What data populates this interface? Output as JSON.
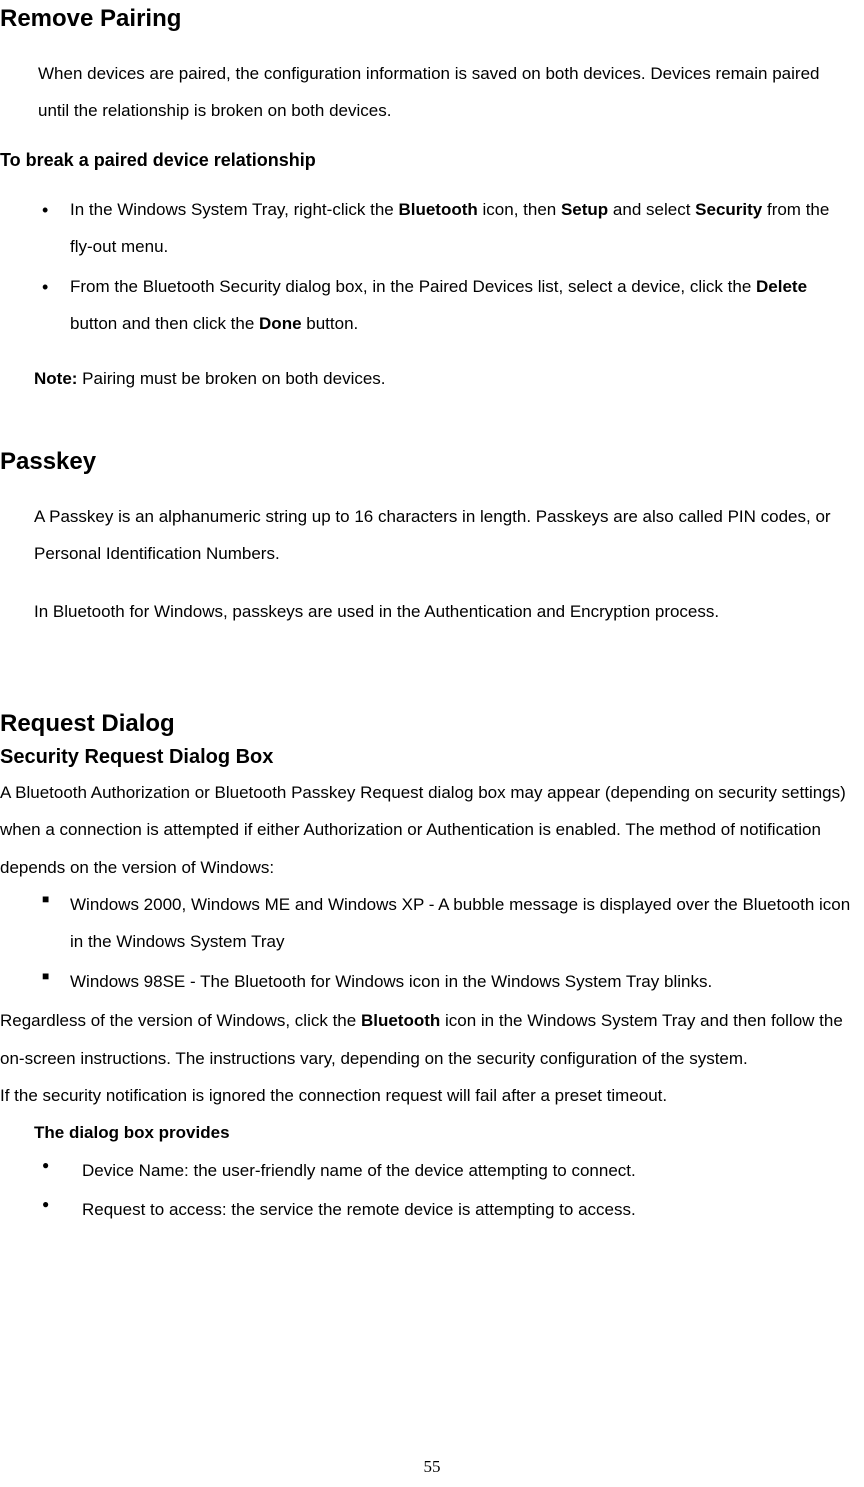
{
  "section1": {
    "heading": "Remove Pairing",
    "intro": "When devices are paired, the configuration information is saved on both devices. Devices remain paired until the relationship is broken on both devices.",
    "subheading": "To break a paired device relationship",
    "bullets": [
      {
        "pre": "In the Windows System Tray, right-click the ",
        "b1": "Bluetooth",
        "mid1": " icon, then ",
        "b2": "Setup",
        "mid2": " and select ",
        "b3": "Security",
        "post": " from the fly-out menu."
      },
      {
        "pre": "From the Bluetooth Security dialog box, in the Paired Devices list, select a device, click the ",
        "b1": "Delete",
        "mid1": " button and then click the ",
        "b2": "Done",
        "post": " button."
      }
    ],
    "note_label": "Note:",
    "note_text": " Pairing must be broken on both devices."
  },
  "section2": {
    "heading": "Passkey",
    "para1": "A Passkey is an alphanumeric string up to 16 characters in length. Passkeys are also called PIN codes, or Personal Identification Numbers.",
    "para2": "In Bluetooth for Windows, passkeys are used in the Authentication and Encryption process."
  },
  "section3": {
    "heading": "Request Dialog",
    "subheading": "Security Request Dialog Box",
    "intro": "A Bluetooth Authorization or Bluetooth Passkey Request dialog box may appear (depending on security settings) when a connection is attempted if either Authorization or Authentication is enabled. The method of notification depends on the version of Windows:",
    "bullets1": [
      "Windows 2000, Windows ME and Windows XP - A bubble message is displayed over the Bluetooth icon in the Windows System Tray",
      "Windows 98SE - The Bluetooth for Windows icon in the Windows System Tray blinks."
    ],
    "para_regardless_pre": "Regardless of the version of Windows, click the ",
    "para_regardless_bold": "Bluetooth",
    "para_regardless_post": " icon in the Windows System Tray and then follow the on-screen instructions. The instructions vary, depending on the security configuration of the system.",
    "para_ignored": "If the security notification is ignored the connection request will fail after a preset timeout.",
    "provides_heading": "The dialog box provides",
    "bullets2": [
      "Device Name: the user-friendly name of the device attempting to connect.",
      "Request to access: the service the remote device is attempting to access."
    ]
  },
  "page_number": "55"
}
